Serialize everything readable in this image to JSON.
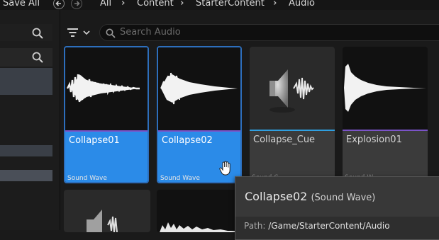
{
  "toolbar": {
    "save_all_label": "Save All"
  },
  "breadcrumb": [
    "All",
    "Content",
    "StarterContent",
    "Audio"
  ],
  "search": {
    "placeholder": "Search Audio"
  },
  "assets": [
    {
      "name": "Collapse01",
      "type": "Sound Wave",
      "selected": true
    },
    {
      "name": "Collapse02",
      "type": "Sound Wave",
      "selected": true
    },
    {
      "name": "Collapse_Cue",
      "type": "Sound C",
      "selected": false
    },
    {
      "name": "Explosion01",
      "type": "Sound W",
      "selected": false
    }
  ],
  "tooltip": {
    "name": "Collapse02",
    "kind": "(Sound Wave)",
    "path_label": "Path:",
    "path_value": "/Game/StarterContent/Audio"
  },
  "colors": {
    "selection": "#2b8be8",
    "cue_strip": "#2f9fe0",
    "wave_strip": "#7b53c8"
  }
}
